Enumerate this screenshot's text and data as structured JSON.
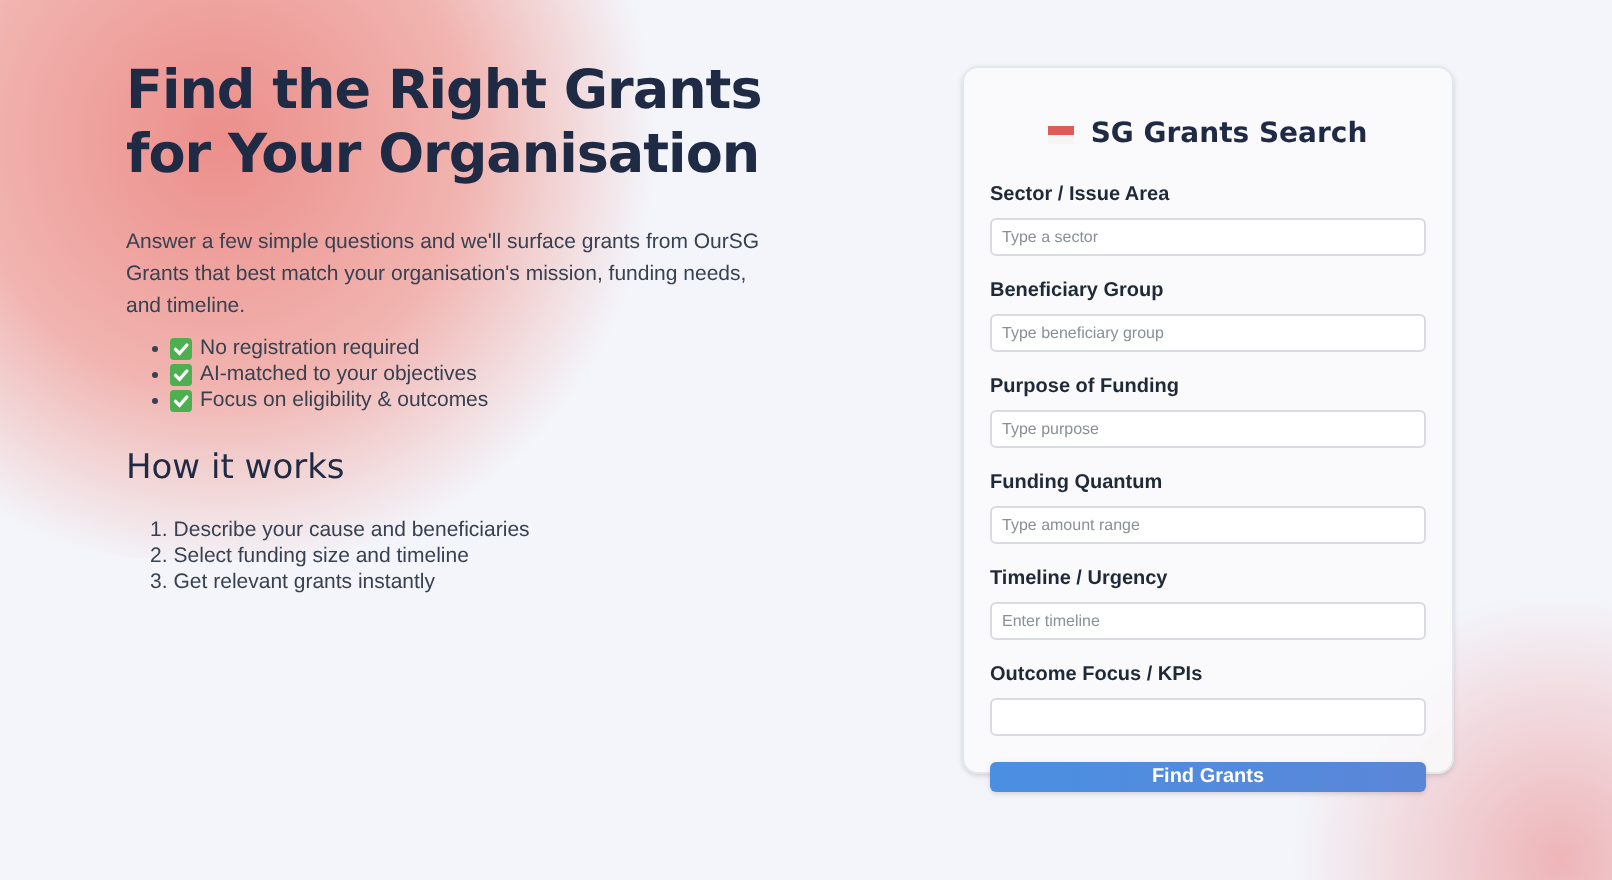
{
  "hero": {
    "title": "Find the Right Grants for Your Organisation",
    "intro": "Answer a few simple questions and we'll surface grants from OurSG Grants that best match your organisation's mission, funding needs, and timeline.",
    "features": [
      {
        "text": "No registration required",
        "checked": true
      },
      {
        "text": "AI-matched to your objectives",
        "checked": true
      },
      {
        "text": "Focus on eligibility & outcomes",
        "checked": true
      }
    ]
  },
  "how_it_works": {
    "heading": "How it works",
    "steps": [
      {
        "number": "1.",
        "text": "Describe your cause and beneficiaries"
      },
      {
        "number": "2.",
        "text": "Select funding size and timeline"
      },
      {
        "number": "3.",
        "text": "Get relevant grants instantly"
      }
    ]
  },
  "search_card": {
    "title": "SG Grants Search",
    "fields": [
      {
        "label": "Sector / Issue Area",
        "placeholder": "Type a sector"
      },
      {
        "label": "Beneficiary Group",
        "placeholder": "Type beneficiary group"
      },
      {
        "label": "Purpose of Funding",
        "placeholder": "Type purpose"
      },
      {
        "label": "Funding Quantum",
        "placeholder": "Type amount range"
      },
      {
        "label": "Timeline / Urgency",
        "placeholder": "Enter timeline"
      },
      {
        "label": "Outcome Focus / KPIs"
      }
    ],
    "button": "Find Grants"
  }
}
